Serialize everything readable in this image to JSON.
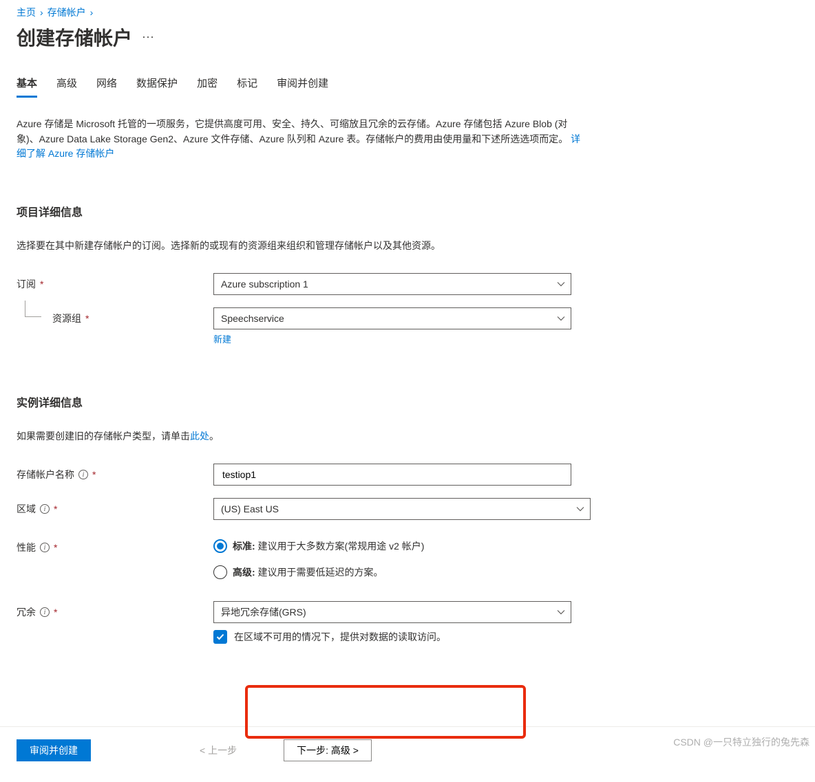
{
  "breadcrumb": {
    "home": "主页",
    "storage": "存储帐户"
  },
  "page_title": "创建存储帐户",
  "tabs": [
    "基本",
    "高级",
    "网络",
    "数据保护",
    "加密",
    "标记",
    "审阅并创建"
  ],
  "active_tab": 0,
  "intro": {
    "body": "Azure 存储是 Microsoft 托管的一项服务，它提供高度可用、安全、持久、可缩放且冗余的云存储。Azure 存储包括 Azure Blob (对象)、Azure Data Lake Storage Gen2、Azure 文件存储、Azure 队列和 Azure 表。存储帐户的费用由使用量和下述所选选项而定。 ",
    "link": "详细了解 Azure 存储帐户"
  },
  "sections": {
    "project": {
      "title": "项目详细信息",
      "desc": "选择要在其中新建存储帐户的订阅。选择新的或现有的资源组来组织和管理存储帐户以及其他资源。",
      "subscription_label": "订阅",
      "subscription_value": "Azure subscription 1",
      "rg_label": "资源组",
      "rg_value": "Speechservice",
      "rg_new": "新建"
    },
    "instance": {
      "title": "实例详细信息",
      "legacy_text": "如果需要创建旧的存储帐户类型，请单击",
      "legacy_link": "此处",
      "name_label": "存储帐户名称",
      "name_value": "testiop1",
      "region_label": "区域",
      "region_value": "(US) East US",
      "perf_label": "性能",
      "perf_std_bold": "标准:",
      "perf_std_rest": " 建议用于大多数方案(常规用途 v2 帐户)",
      "perf_prem_bold": "高级:",
      "perf_prem_rest": " 建议用于需要低延迟的方案。",
      "redundancy_label": "冗余",
      "redundancy_value": "异地冗余存储(GRS)",
      "redundancy_cb": "在区域不可用的情况下，提供对数据的读取访问。"
    }
  },
  "footer": {
    "review": "审阅并创建",
    "prev": "< 上一步",
    "next": "下一步: 高级 >"
  },
  "watermark": "CSDN @一只特立独行的兔先森"
}
